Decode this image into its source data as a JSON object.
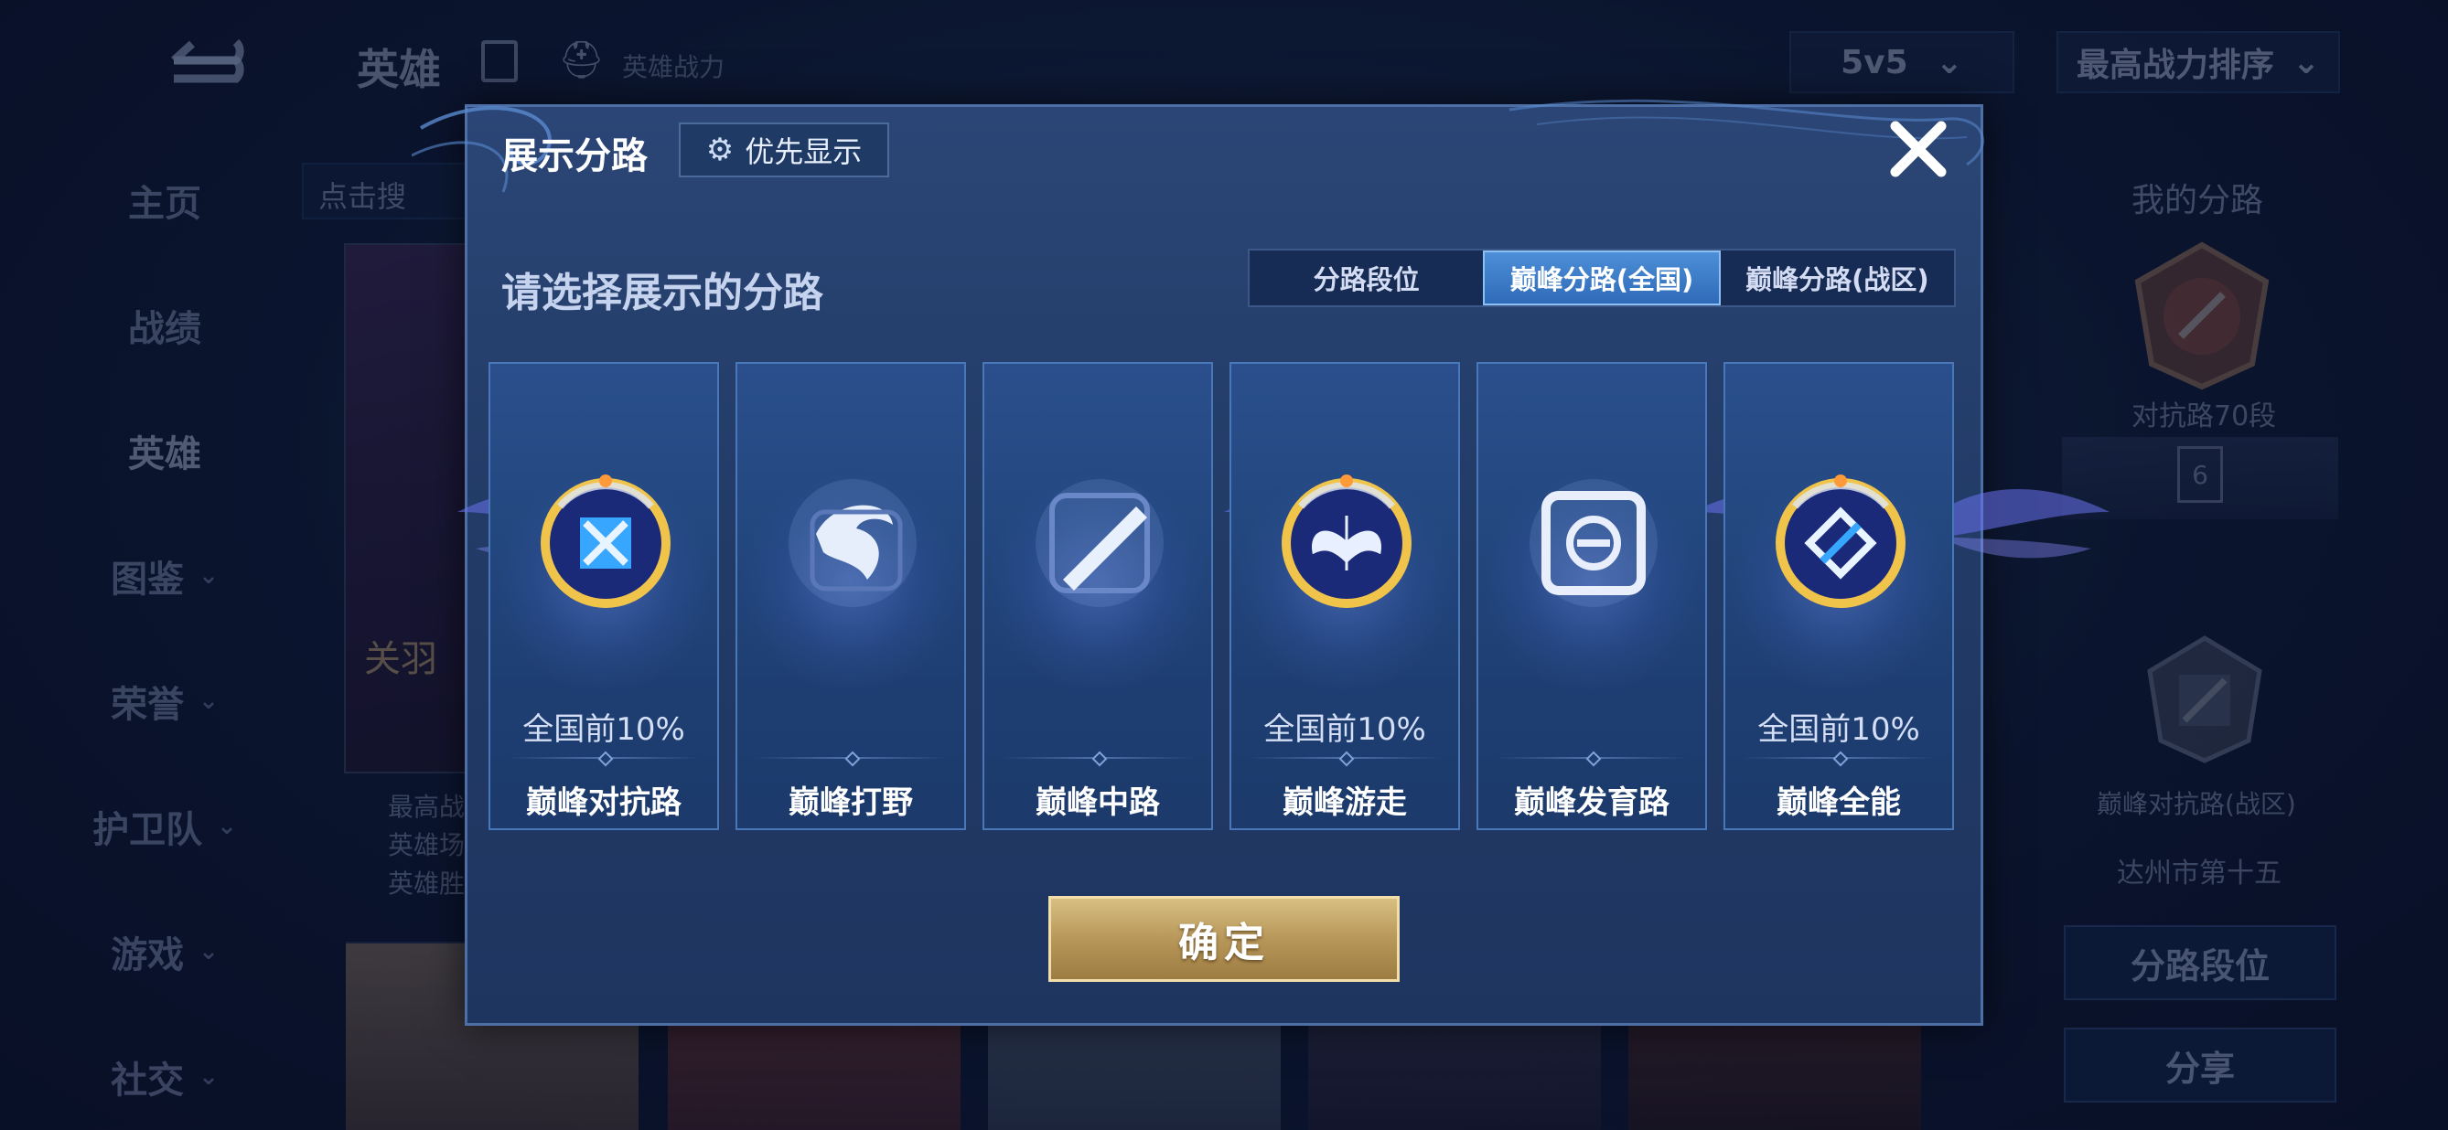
{
  "background": {
    "nav_title": "英雄",
    "power_label": "英雄战力",
    "mode": "5v5",
    "sort": "最高战力排序",
    "search_placeholder": "点击搜",
    "hero_name": "关羽",
    "hero_info": [
      "最高战",
      "英雄场",
      "英雄胜"
    ],
    "sidebar": [
      {
        "label": "主页",
        "has_chevron": false
      },
      {
        "label": "战绩",
        "has_chevron": false
      },
      {
        "label": "英雄",
        "has_chevron": false
      },
      {
        "label": "图鉴",
        "has_chevron": true
      },
      {
        "label": "荣誉",
        "has_chevron": true
      },
      {
        "label": "护卫队",
        "has_chevron": true
      },
      {
        "label": "游戏",
        "has_chevron": true
      },
      {
        "label": "社交",
        "has_chevron": true
      }
    ],
    "right_panel": {
      "title": "我的分路",
      "rank_label": "对抗路70段",
      "ribbon_number": "6",
      "peak_label": "巅峰对抗路(战区)",
      "region": "达州市第十五",
      "lane_rank_button": "分路段位",
      "share_button": "分享"
    }
  },
  "dialog": {
    "title": "展示分路",
    "priority_button": "优先显示",
    "prompt": "请选择展示的分路",
    "tabs": [
      {
        "label": "分路段位",
        "active": false
      },
      {
        "label": "巅峰分路(全国)",
        "active": true
      },
      {
        "label": "巅峰分路(战区)",
        "active": false
      }
    ],
    "cards": [
      {
        "lane": "巅峰对抗路",
        "rank": "全国前10%",
        "icon": "sword-emblem-icon",
        "ranked": true
      },
      {
        "lane": "巅峰打野",
        "rank": "",
        "icon": "dragon-emblem-icon",
        "ranked": false
      },
      {
        "lane": "巅峰中路",
        "rank": "",
        "icon": "slash-emblem-icon",
        "ranked": false
      },
      {
        "lane": "巅峰游走",
        "rank": "全国前10%",
        "icon": "wings-emblem-icon",
        "ranked": true
      },
      {
        "lane": "巅峰发育路",
        "rank": "",
        "icon": "swirl-emblem-icon",
        "ranked": false
      },
      {
        "lane": "巅峰全能",
        "rank": "全国前10%",
        "icon": "diamond-emblem-icon",
        "ranked": true
      }
    ],
    "confirm_button": "确定"
  },
  "colors": {
    "accent_blue": "#3f7fcc",
    "gold": "#c9a866",
    "dialog_bg": "#223b67"
  }
}
